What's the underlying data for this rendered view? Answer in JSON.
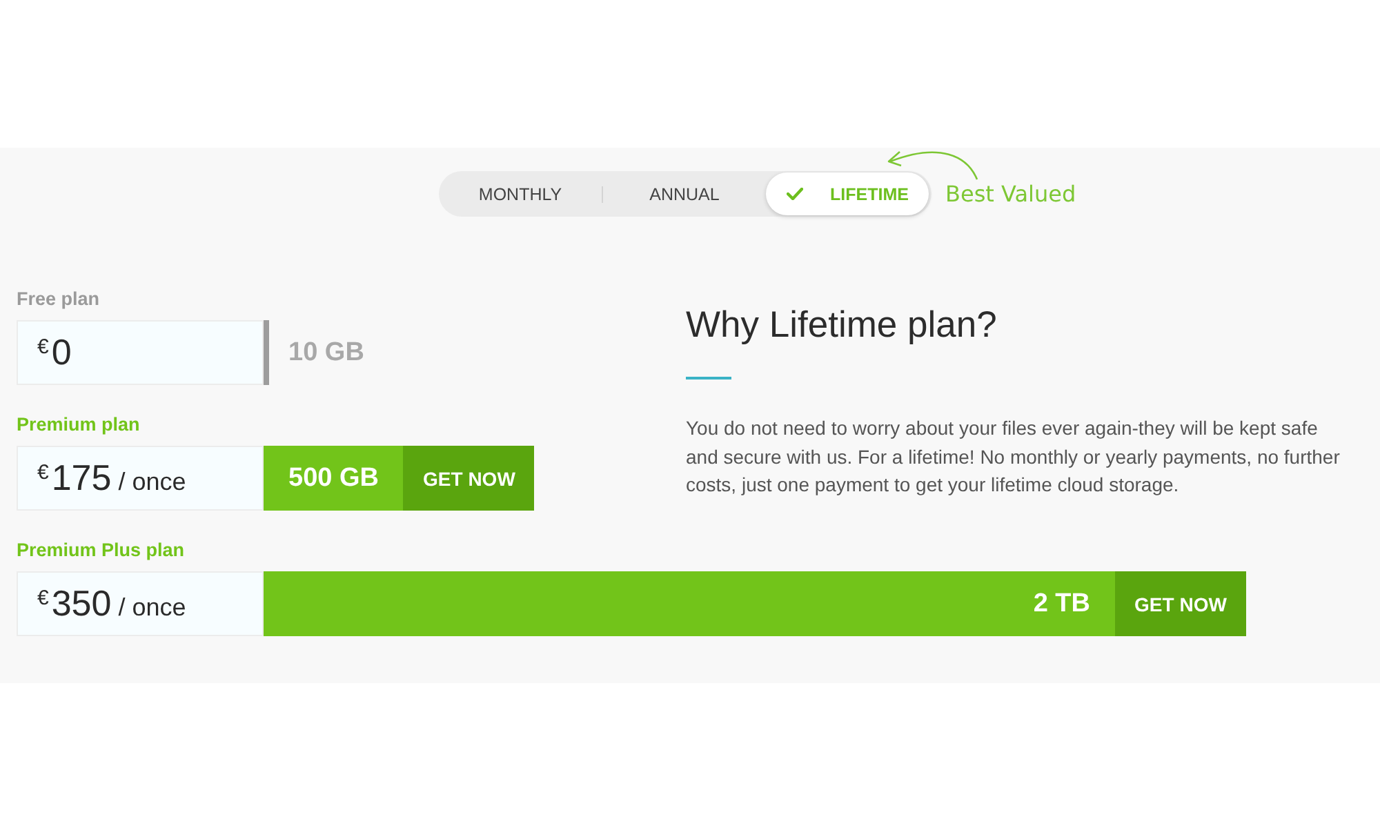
{
  "pricing_toggle": {
    "tabs": [
      {
        "label": "MONTHLY",
        "selected": false
      },
      {
        "label": "ANNUAL",
        "selected": false
      },
      {
        "label": "LIFETIME",
        "selected": true
      }
    ],
    "callout": "Best Valued"
  },
  "plans": [
    {
      "kind": "free",
      "name": "Free plan",
      "price": {
        "currency": "€",
        "amount": "0"
      },
      "storage": "10 GB"
    },
    {
      "kind": "compact",
      "name": "Premium plan",
      "price": {
        "currency": "€",
        "amount": "175",
        "period": "/ once"
      },
      "storage": "500 GB",
      "button": "GET NOW"
    },
    {
      "kind": "stretched",
      "name": "Premium Plus plan",
      "price": {
        "currency": "€",
        "amount": "350",
        "period": "/ once"
      },
      "storage": "2 TB",
      "button": "GET NOW"
    }
  ],
  "info": {
    "heading": "Why Lifetime plan?",
    "body": "You do not need to worry about your files ever again-they will be kept safe and secure with us. For a lifetime! No monthly or yearly payments, no further costs, just one payment to get your lifetime cloud storage."
  }
}
